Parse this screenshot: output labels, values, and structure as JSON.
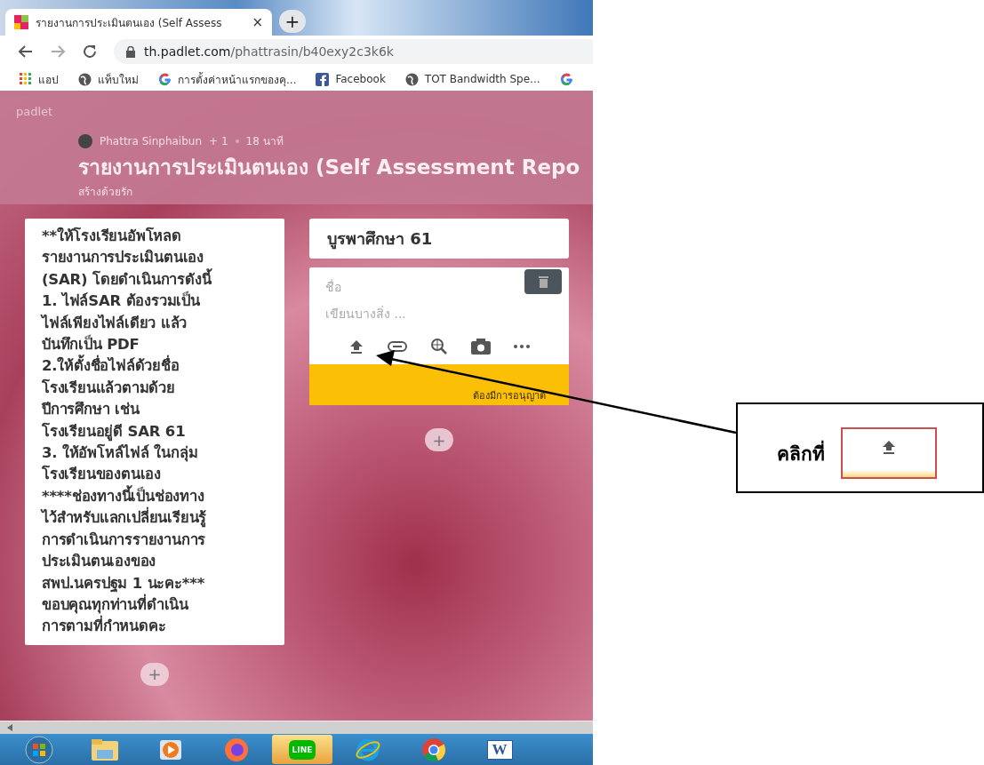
{
  "browser": {
    "tab": {
      "title": "รายงานการประเมินตนเอง (Self Assess",
      "close": "×",
      "selected": true
    },
    "new_tab": "+",
    "url": {
      "host": "th.padlet.com",
      "path": "/phattrasin/b40exy2c3k6k"
    },
    "bookmarks": [
      {
        "kind": "apps",
        "label": "แอป"
      },
      {
        "kind": "globe",
        "label": "แท็บใหม่"
      },
      {
        "kind": "google",
        "label": "การตั้งค่าหน้าแรกของคุ..."
      },
      {
        "kind": "facebook",
        "label": "Facebook"
      },
      {
        "kind": "globe",
        "label": "TOT Bandwidth Spe..."
      },
      {
        "kind": "google"
      }
    ]
  },
  "padlet": {
    "brand": "padlet",
    "author": "Phattra Sinphaibun",
    "collaborators": "+ 1",
    "time": "18 นาที",
    "title": "รายงานการประเมินตนเอง (Self Assessment Repo",
    "subtitle": "สร้างด้วยรัก",
    "columns": [
      {
        "kind": "post",
        "text": "**ให้โรงเรียนอัพโหลด\nรายงานการประเมินตนเอง\n(SAR) โดยดำเนินการดังนี้\n1. ไฟล์SAR ต้องรวมเป็น\nไฟล์เพียงไฟล์เดียว แล้ว\nบันทึกเป็น PDF\n2.ให้ตั้งชื่อไฟล์ด้วยชื่อ\nโรงเรียนแล้วตามด้วย\nปีการศึกษา เช่น\nโรงเรียนอยู่ดี SAR 61\n3. ให้อัพโหล์ไฟล์ ในกลุ่ม\nโรงเรียนของตนเอง\n****ช่องทางนี้เป็นช่องทาง\nไว้สำหรับแลกเปลี่ยนเรียนรู้\nการดำเนินการรายงานการ\nประเมินตนเองของ\nสพป.นครปฐม 1 นะคะ***\nขอบคุณทุกท่านที่ดำเนิน\nการตามที่กำหนดคะ",
        "add": "+"
      },
      {
        "kind": "section",
        "title": "บูรพาศึกษา 61",
        "composer": {
          "title_placeholder": "ชื่อ",
          "body_placeholder": "เขียนบางสิ่ง ...",
          "footer": "ต้องมีการอนุญาต"
        },
        "add": "+"
      }
    ]
  },
  "taskbar": [
    {
      "kind": "start"
    },
    {
      "kind": "explorer"
    },
    {
      "kind": "media"
    },
    {
      "kind": "firefox"
    },
    {
      "kind": "line",
      "label": "LINE",
      "selected": true
    },
    {
      "kind": "ie"
    },
    {
      "kind": "chrome"
    },
    {
      "kind": "word",
      "label": "W"
    }
  ],
  "callout": {
    "text": "คลิกที่"
  }
}
